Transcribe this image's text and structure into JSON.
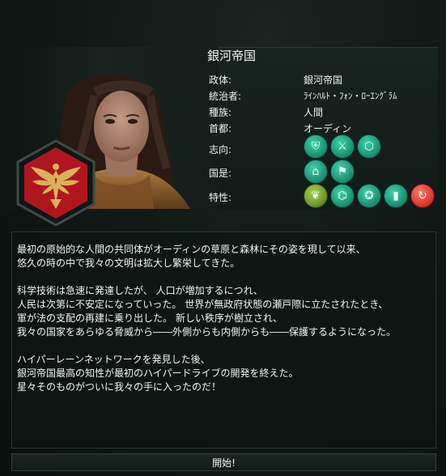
{
  "empire": {
    "name": "銀河帝国",
    "rows": [
      {
        "label": "政体:",
        "value": "銀河帝国"
      },
      {
        "label": "統治者:",
        "value": "ﾗｲﾝﾊﾙﾄ・ﾌｫﾝ・ﾛｰｴﾝｸﾞﾗﾑ"
      },
      {
        "label": "種族:",
        "value": "人間"
      },
      {
        "label": "首都:",
        "value": "オーディン"
      },
      {
        "label": "志向:",
        "value": ""
      },
      {
        "label": "国是:",
        "value": ""
      },
      {
        "label": "特性:",
        "value": ""
      }
    ],
    "ethics_icons": [
      "shield-ethic-icon",
      "crossed-swords-icon",
      "hexagon-network-icon"
    ],
    "civics_icons": [
      "police-cap-icon",
      "tag-flag-icon"
    ],
    "traits_icons": [
      "leaf-icon",
      "graduation-cap-icon",
      "medal-icon",
      "cylinder-icon",
      "red-cycle-icon"
    ],
    "colors": {
      "ethic_teal": "#1f9b7a",
      "trait_green": "#6f9c2a",
      "trait_red": "#e03a2f",
      "emblem_red": "#b0161e",
      "emblem_gold": "#d9b25a"
    }
  },
  "story": {
    "paragraphs": [
      "最初の原始的な人間の共同体がオーディンの草原と森林にその姿を現して以来、\n悠久の時の中で我々の文明は拡大し繁栄してきた。",
      "科学技術は急速に発達したが、 人口が増加するにつれ、\n人民は次第に不安定になっていった。 世界が無政府状態の瀬戸際に立たされたとき、\n軍が法の支配の再建に乗り出した。 新しい秩序が樹立され、\n我々の国家をあらゆる脅威から――外側からも内側からも――保護するようになった。",
      "ハイパーレーンネットワークを発見した後、\n銀河帝国最高の知性が最初のハイパードライブの開発を終えた。\n星々そのものがついに我々の手に入ったのだ！"
    ]
  },
  "start_button": "開始!"
}
